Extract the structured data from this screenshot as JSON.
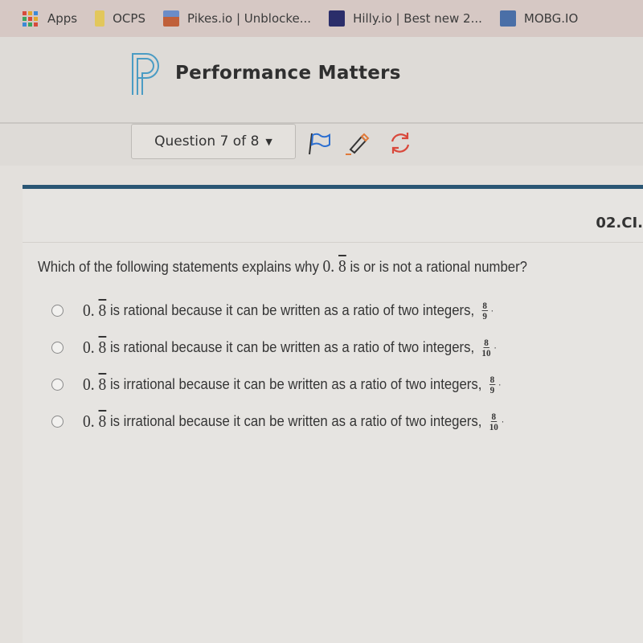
{
  "bookmarks": [
    {
      "label": "Apps",
      "icon": "apps-grid-icon"
    },
    {
      "label": "OCPS",
      "icon": "ocps-icon"
    },
    {
      "label": "Pikes.io | Unblocke...",
      "icon": "pikes-icon"
    },
    {
      "label": "Hilly.io | Best new 2...",
      "icon": "hilly-icon"
    },
    {
      "label": "MOBG.IO",
      "icon": "mobg-icon"
    }
  ],
  "header": {
    "brand": "Performance Matters",
    "logo_icon": "performance-matters-logo"
  },
  "toolbar": {
    "question_selector": "Question 7 of 8",
    "icons": [
      "flag-icon",
      "pencil-icon",
      "refresh-icon"
    ]
  },
  "colors": {
    "accent_bar": "#2a5674",
    "flag": "#2c6fd1",
    "pencil": "#e07a3a",
    "refresh": "#d9483b"
  },
  "item": {
    "code": "02.CI."
  },
  "question": {
    "prefix": "Which of the following statements explains why ",
    "number_int": "0.",
    "number_repeat": "8",
    "suffix": " is or is not a rational number?"
  },
  "options": [
    {
      "num_int": "0.",
      "num_repeat": "8",
      "text": " is rational because it can be written as a ratio of two integers,",
      "frac_num": "8",
      "frac_den": "9",
      "selected": false
    },
    {
      "num_int": "0.",
      "num_repeat": "8",
      "text": " is rational because it can be written as a ratio of two integers,",
      "frac_num": "8",
      "frac_den": "10",
      "selected": false
    },
    {
      "num_int": "0.",
      "num_repeat": "8",
      "text": " is irrational because it can be written as a ratio of two integers,",
      "frac_num": "8",
      "frac_den": "9",
      "selected": false
    },
    {
      "num_int": "0.",
      "num_repeat": "8",
      "text": " is irrational because it can be written as a ratio of two integers,",
      "frac_num": "8",
      "frac_den": "10",
      "selected": false
    }
  ]
}
